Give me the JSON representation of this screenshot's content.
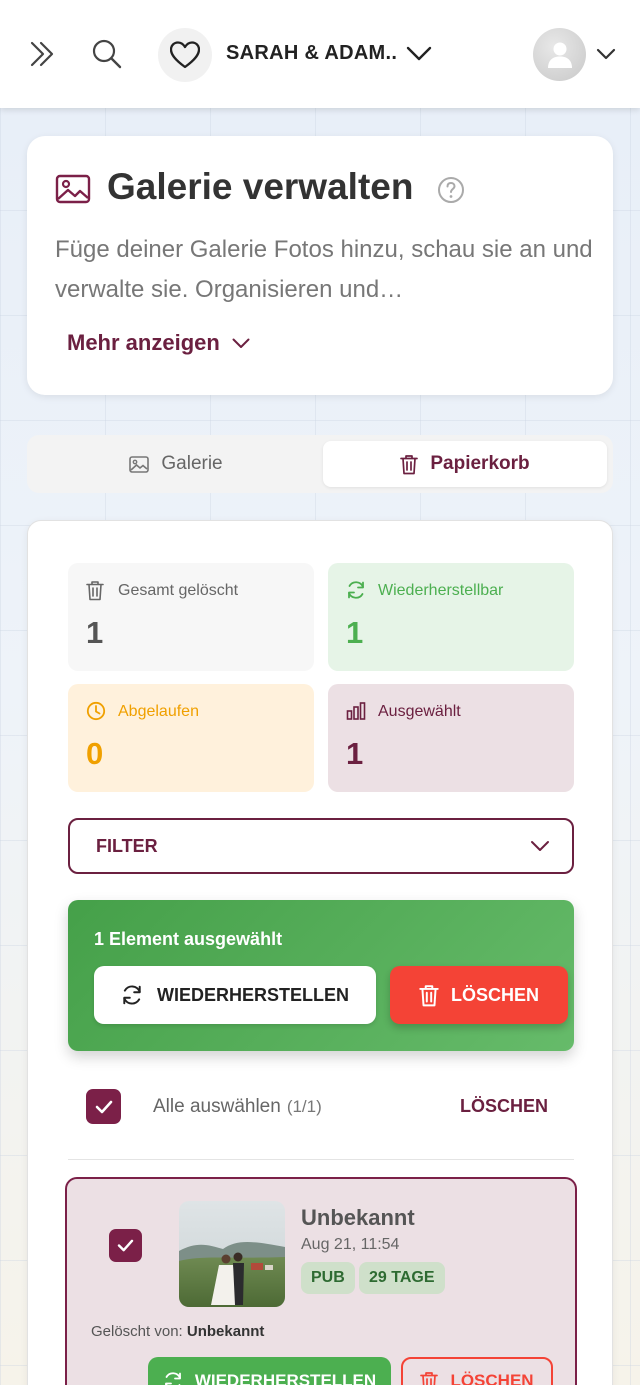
{
  "header": {
    "couple_name": "SARAH & ADAM...",
    "icons": [
      "expand-double-chevron-icon",
      "search-icon",
      "heart-icon",
      "chevron-down-icon",
      "user-avatar-icon"
    ]
  },
  "info": {
    "title": "Galerie verwalten",
    "description": "Füge deiner Galerie Fotos hinzu, schau sie an und verwalte sie. Organisieren und…",
    "more_label": "Mehr anzeigen"
  },
  "tabs": {
    "gallery": "Galerie",
    "trash": "Papierkorb",
    "active": "trash"
  },
  "stats": {
    "total_deleted": {
      "label": "Gesamt gelöscht",
      "value": "1"
    },
    "restorable": {
      "label": "Wiederherstellbar",
      "value": "1"
    },
    "expired": {
      "label": "Abgelaufen",
      "value": "0"
    },
    "selected": {
      "label": "Ausgewählt",
      "value": "1"
    }
  },
  "filter": {
    "label": "FILTER"
  },
  "selection_bar": {
    "text": "1 Element ausgewählt",
    "restore_label": "WIEDERHERSTELLEN",
    "delete_label": "LÖSCHEN"
  },
  "select_all": {
    "label": "Alle auswählen",
    "count": "(1/1)",
    "delete_label": "LÖSCHEN",
    "checked": true
  },
  "items": [
    {
      "title": "Unbekannt",
      "date": "Aug 21, 11:54",
      "badge_status": "PUB",
      "badge_days": "29 TAGE",
      "deleted_by_label": "Gelöscht von:",
      "deleted_by": "Unbekannt",
      "restore_label": "WIEDERHERSTELLEN",
      "delete_label": "LÖSCHEN",
      "checked": true
    }
  ],
  "colors": {
    "brand": "#6b2040",
    "success": "#4caf50",
    "danger": "#f44336",
    "warning": "#f0a000"
  }
}
